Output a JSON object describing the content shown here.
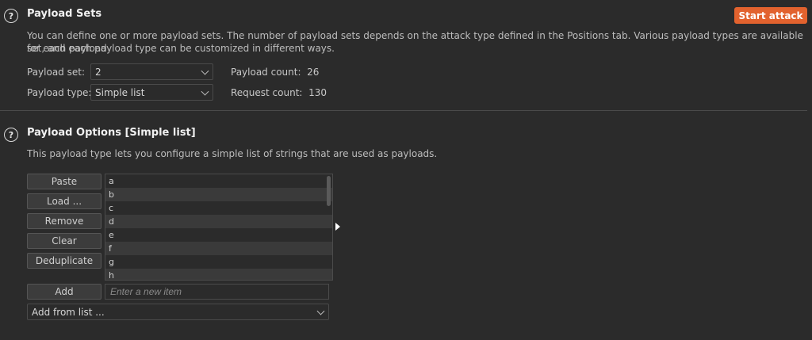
{
  "payload_sets": {
    "title": "Payload Sets",
    "description_line1": "You can define one or more payload sets. The number of payload sets depends on the attack type defined in the Positions tab. Various payload types are available for each payload",
    "description_line2": "set, and each payload type can be customized in different ways.",
    "start_attack_label": "Start attack",
    "payload_set_label": "Payload set:",
    "payload_set_value": "2",
    "payload_type_label": "Payload type:",
    "payload_type_value": "Simple list",
    "payload_count_label": "Payload count:",
    "payload_count_value": "26",
    "request_count_label": "Request count:",
    "request_count_value": "130"
  },
  "payload_options": {
    "title": "Payload Options [Simple list]",
    "description": "This payload type lets you configure a simple list of strings that are used as payloads.",
    "buttons": {
      "paste": "Paste",
      "load": "Load ...",
      "remove": "Remove",
      "clear": "Clear",
      "deduplicate": "Deduplicate",
      "add": "Add"
    },
    "items": [
      "a",
      "b",
      "c",
      "d",
      "e",
      "f",
      "g",
      "h"
    ],
    "new_item_placeholder": "Enter a new item",
    "add_from_list_label": "Add from list ..."
  },
  "icons": {
    "help": "?"
  },
  "colors": {
    "accent": "#e2622e",
    "background": "#2b2b2b"
  }
}
